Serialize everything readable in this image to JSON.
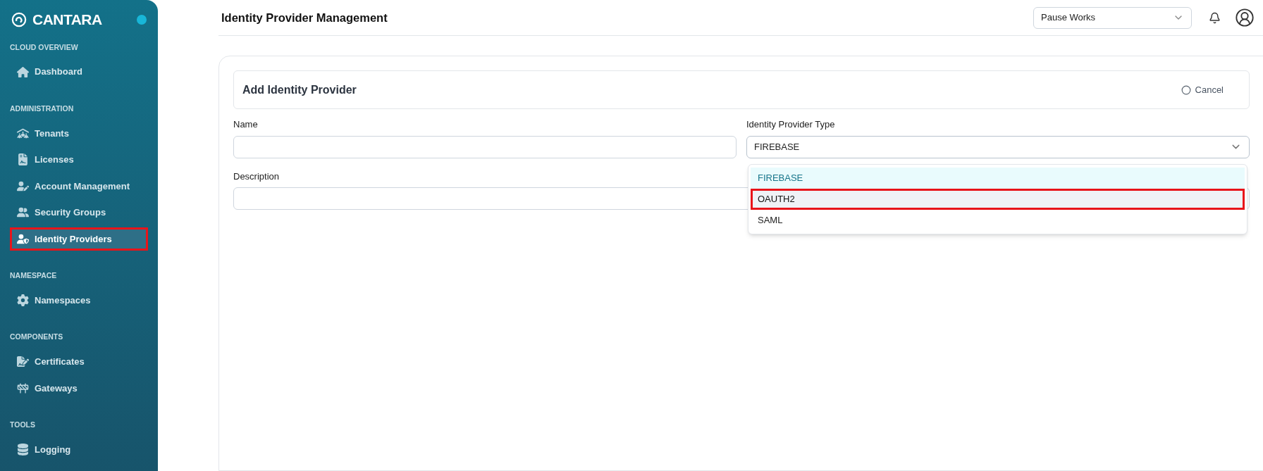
{
  "brand": {
    "name": "CANTARA"
  },
  "sidebar": {
    "sections": [
      {
        "title": "CLOUD OVERVIEW",
        "items": [
          {
            "label": "Dashboard",
            "selected": false,
            "highlighted": false
          }
        ]
      },
      {
        "title": "ADMINISTRATION",
        "items": [
          {
            "label": "Tenants",
            "selected": false,
            "highlighted": false
          },
          {
            "label": "Licenses",
            "selected": false,
            "highlighted": false
          },
          {
            "label": "Account Management",
            "selected": false,
            "highlighted": false
          },
          {
            "label": "Security Groups",
            "selected": false,
            "highlighted": false
          },
          {
            "label": "Identity Providers",
            "selected": true,
            "highlighted": true
          }
        ]
      },
      {
        "title": "NAMESPACE",
        "items": [
          {
            "label": "Namespaces",
            "selected": false,
            "highlighted": false
          }
        ]
      },
      {
        "title": "COMPONENTS",
        "items": [
          {
            "label": "Certificates",
            "selected": false,
            "highlighted": false
          },
          {
            "label": "Gateways",
            "selected": false,
            "highlighted": false
          }
        ]
      },
      {
        "title": "TOOLS",
        "items": [
          {
            "label": "Logging",
            "selected": false,
            "highlighted": false
          }
        ]
      }
    ]
  },
  "header": {
    "title": "Identity Provider Management",
    "workspace_select": {
      "value": "Pause Works"
    }
  },
  "form": {
    "title": "Add Identity Provider",
    "cancel_button": "Cancel",
    "name_field": {
      "label": "Name"
    },
    "description_field": {
      "label": "Description"
    },
    "type_select": {
      "label": "Identity Provider Type",
      "value": "FIREBASE",
      "expanded": true,
      "options": [
        {
          "label": "FIREBASE",
          "selected": true,
          "highlighted": false
        },
        {
          "label": "OAUTH2",
          "selected": false,
          "highlighted": true
        },
        {
          "label": "SAML",
          "selected": false,
          "highlighted": false
        }
      ]
    }
  }
}
